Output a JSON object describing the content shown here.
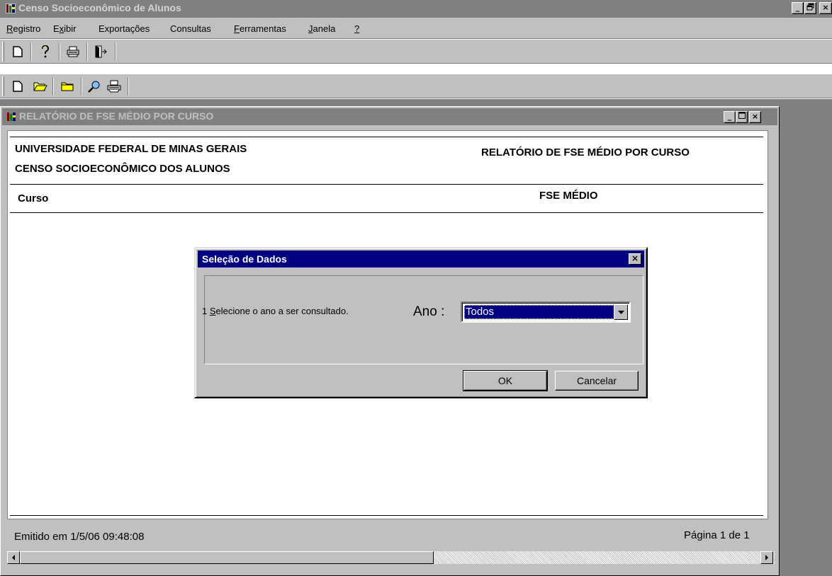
{
  "app": {
    "title": "Censo Socioeconômico de Alunos",
    "window_controls": {
      "minimize": "_",
      "maximize": "̈",
      "close": "×"
    }
  },
  "menu": [
    {
      "label": "Registro"
    },
    {
      "label": "Exibir"
    },
    {
      "label": "Exportações"
    },
    {
      "label": "Consultas"
    },
    {
      "label": "Ferramentas"
    },
    {
      "label": "Janela"
    },
    {
      "label": "?"
    }
  ],
  "toolbar1": [
    "new-icon",
    "help-icon",
    "print-icon",
    "exit-icon"
  ],
  "toolbar2": [
    "new-icon",
    "open-folder-icon",
    "folder-icon",
    "search-icon",
    "print-icon"
  ],
  "report_window": {
    "title": "RELATÓRIO DE FSE MÉDIO  POR CURSO",
    "controls": {
      "minimize": "_",
      "maximize": "□",
      "close": "×"
    }
  },
  "report": {
    "institution": "UNIVERSIDADE FEDERAL DE MINAS GERAIS",
    "census": "CENSO SOCIOECONÔMICO DOS ALUNOS",
    "title": "RELATÓRIO DE FSE MÉDIO  POR CURSO",
    "col_course": "Curso",
    "col_fse": "FSE MÉDIO",
    "issued": "Emitido em 1/5/06 09:48:08",
    "page": "Página 1 de 1"
  },
  "dialog": {
    "title": "Seleção de Dados",
    "close": "×",
    "instruction": "1 Selecione o ano a ser consultado.",
    "year_label": "Ano :",
    "year_value": "Todos",
    "ok": "OK",
    "cancel": "Cancelar"
  },
  "colors": {
    "dialog_title": "#000080",
    "face": "#c0c0c0",
    "inactive_title": "#808080"
  }
}
